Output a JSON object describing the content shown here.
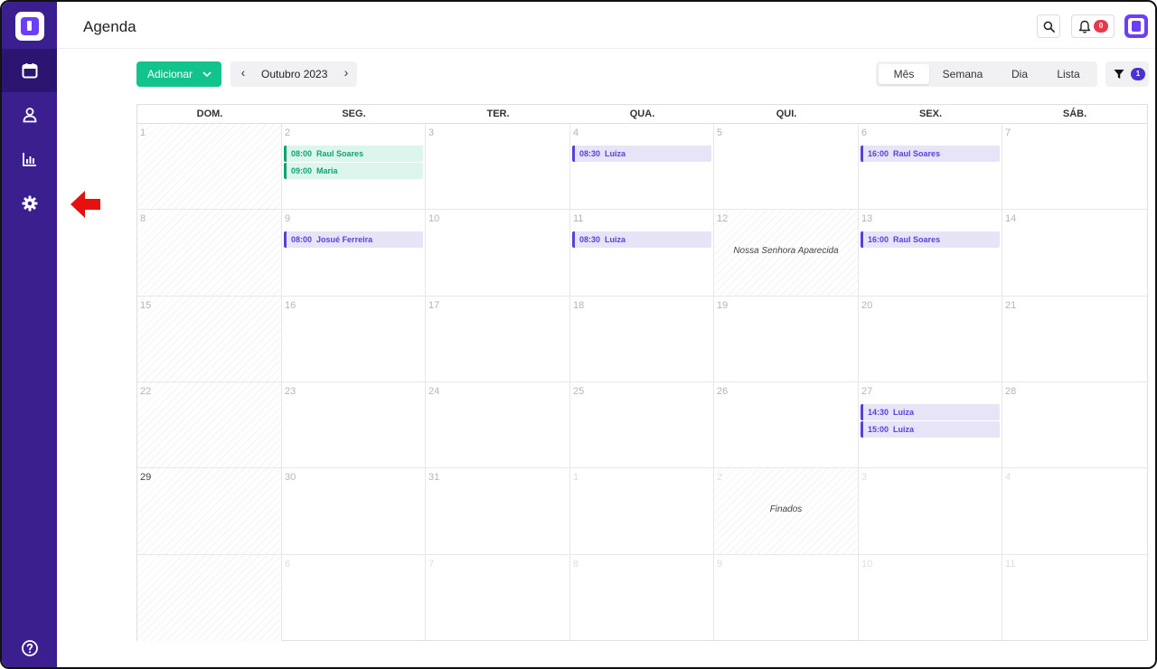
{
  "app": {
    "page_title": "Agenda"
  },
  "header": {
    "notification_count": "0"
  },
  "toolbar": {
    "add_label": "Adicionar",
    "prev_label": "‹",
    "next_label": "›",
    "current_month": "Outubro 2023",
    "views": [
      "Mês",
      "Semana",
      "Dia",
      "Lista"
    ],
    "active_view": "Mês",
    "filter_count": "1"
  },
  "calendar": {
    "weekdays": [
      "DOM.",
      "SEG.",
      "TER.",
      "QUA.",
      "QUI.",
      "SEX.",
      "SÁB."
    ],
    "weeks": [
      [
        {
          "day": "1",
          "muted": false,
          "hatched": true
        },
        {
          "day": "2",
          "events": [
            {
              "time": "08:00",
              "title": "Raul Soares",
              "color": "green"
            },
            {
              "time": "09:00",
              "title": "Maria",
              "color": "green"
            }
          ]
        },
        {
          "day": "3"
        },
        {
          "day": "4",
          "events": [
            {
              "time": "08:30",
              "title": "Luiza",
              "color": "purple"
            }
          ]
        },
        {
          "day": "5"
        },
        {
          "day": "6",
          "events": [
            {
              "time": "16:00",
              "title": "Raul Soares",
              "color": "purple"
            }
          ]
        },
        {
          "day": "7"
        }
      ],
      [
        {
          "day": "8",
          "hatched": true
        },
        {
          "day": "9",
          "events": [
            {
              "time": "08:00",
              "title": "Josué Ferreira",
              "color": "purple"
            }
          ]
        },
        {
          "day": "10"
        },
        {
          "day": "11",
          "events": [
            {
              "time": "08:30",
              "title": "Luiza",
              "color": "purple"
            }
          ]
        },
        {
          "day": "12",
          "hatched": true,
          "holiday": "Nossa Senhora Aparecida"
        },
        {
          "day": "13",
          "events": [
            {
              "time": "16:00",
              "title": "Raul Soares",
              "color": "purple"
            }
          ]
        },
        {
          "day": "14"
        }
      ],
      [
        {
          "day": "15",
          "hatched": true
        },
        {
          "day": "16"
        },
        {
          "day": "17"
        },
        {
          "day": "18"
        },
        {
          "day": "19"
        },
        {
          "day": "20"
        },
        {
          "day": "21"
        }
      ],
      [
        {
          "day": "22",
          "hatched": true
        },
        {
          "day": "23"
        },
        {
          "day": "24"
        },
        {
          "day": "25"
        },
        {
          "day": "26"
        },
        {
          "day": "27",
          "events": [
            {
              "time": "14:30",
              "title": "Luiza",
              "color": "purple"
            },
            {
              "time": "15:00",
              "title": "Luiza",
              "color": "purple"
            }
          ]
        },
        {
          "day": "28"
        }
      ],
      [
        {
          "day": "29",
          "hatched": true,
          "strong": true
        },
        {
          "day": "30"
        },
        {
          "day": "31"
        },
        {
          "day": "1",
          "faded": true
        },
        {
          "day": "2",
          "faded": true,
          "hatched": true,
          "holiday": "Finados"
        },
        {
          "day": "3",
          "faded": true
        },
        {
          "day": "4",
          "faded": true
        }
      ],
      [
        {
          "day": "",
          "hatched": true
        },
        {
          "day": "6",
          "faded": true
        },
        {
          "day": "7",
          "faded": true
        },
        {
          "day": "8",
          "faded": true
        },
        {
          "day": "9",
          "faded": true
        },
        {
          "day": "10",
          "faded": true
        },
        {
          "day": "11",
          "faded": true
        }
      ]
    ]
  },
  "sidebar": {
    "items": [
      {
        "name": "calendar-icon",
        "active": true
      },
      {
        "name": "user-icon",
        "active": false
      },
      {
        "name": "bar-chart-icon",
        "active": false
      },
      {
        "name": "gear-icon",
        "active": false
      }
    ],
    "help_icon": "help-icon"
  },
  "colors": {
    "sidebar": "#3b1f8f",
    "primary": "#12c48b",
    "accent": "#5b3fd6",
    "badge_red": "#e53950",
    "arrow_red": "#e8100f"
  }
}
